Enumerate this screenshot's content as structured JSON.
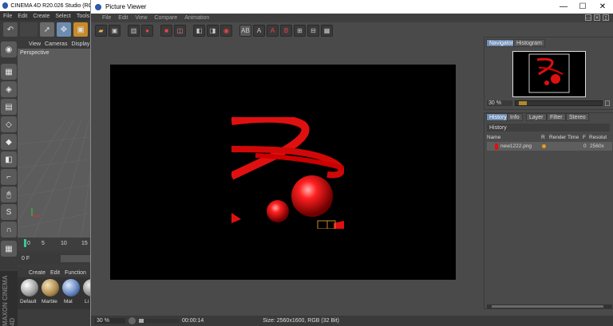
{
  "c4d": {
    "title": "CINEMA 4D R20.026 Studio (RC -",
    "menu": [
      "File",
      "Edit",
      "Create",
      "Select",
      "Tools"
    ],
    "viewport_menu": [
      "View",
      "Cameras",
      "Display"
    ],
    "viewport_label": "Perspective",
    "timeline_ticks": [
      "0",
      "5",
      "10",
      "15"
    ],
    "frame_value": "0 F",
    "material_menu": [
      "Create",
      "Edit",
      "Function"
    ],
    "materials": [
      "Default",
      "Marble",
      "Mat",
      "Li"
    ],
    "brand": "MAXON CINEMA 4D"
  },
  "pv": {
    "title": "Picture Viewer",
    "menu": [
      "File",
      "Edit",
      "View",
      "Compare",
      "Animation"
    ],
    "window_controls": {
      "minimize": "—",
      "maximize": "☐",
      "close": "✕"
    },
    "navigator_tabs": [
      "Navigator",
      "Histogram"
    ],
    "nav_zoom": "30 %",
    "history_tabs": [
      "History",
      "Info",
      "Layer",
      "Filter",
      "Stereo"
    ],
    "history_title": "History",
    "history_columns": [
      "Name",
      "R",
      "Render Time",
      "F",
      "Resolut"
    ],
    "history_row": {
      "name": "new1222.png",
      "frame": "0",
      "resolution": "2560x"
    },
    "status_zoom": "30 %",
    "status_time": "00:00:14",
    "status_size": "Size: 2560x1600, RGB (32 Bit)"
  },
  "colors": {
    "accent": "#6e8cb2",
    "render_red": "#e01010",
    "status_dot": "#e89a1a"
  }
}
